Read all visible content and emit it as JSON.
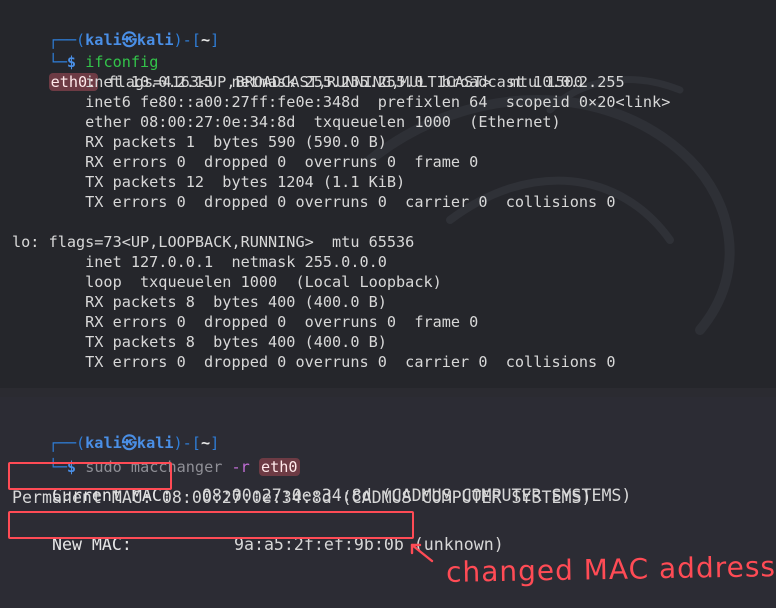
{
  "panel1": {
    "prompt": {
      "open": "┌──(",
      "user": "kali",
      "at": "㉿",
      "host": "kali",
      "close": ")-[",
      "path": "~",
      "end": "]"
    },
    "prompt2": {
      "lead": "└─",
      "dollar": "$",
      "command": "ifconfig"
    },
    "eth0_label": "eth0:",
    "eth0_lines": [
      "flags=4163<UP,BROADCAST,RUNNING,MULTICAST>  mtu 1500",
      "        inet 10.0.2.15  netmask 255.255.255.0  broadcast 10.0.2.255",
      "        inet6 fe80::a00:27ff:fe0e:348d  prefixlen 64  scopeid 0×20<link>",
      "        ether 08:00:27:0e:34:8d  txqueuelen 1000  (Ethernet)",
      "        RX packets 1  bytes 590 (590.0 B)",
      "        RX errors 0  dropped 0  overruns 0  frame 0",
      "        TX packets 12  bytes 1204 (1.1 KiB)",
      "        TX errors 0  dropped 0 overruns 0  carrier 0  collisions 0"
    ],
    "lo_lines": [
      "lo: flags=73<UP,LOOPBACK,RUNNING>  mtu 65536",
      "        inet 127.0.0.1  netmask 255.0.0.0",
      "        loop  txqueuelen 1000  (Local Loopback)",
      "        RX packets 8  bytes 400 (400.0 B)",
      "        RX errors 0  dropped 0  overruns 0  frame 0",
      "        TX packets 8  bytes 400 (400.0 B)",
      "        TX errors 0  dropped 0 overruns 0  carrier 0  collisions 0"
    ]
  },
  "panel2": {
    "prompt": {
      "open": "┌──(",
      "user": "kali",
      "at": "㉿",
      "host": "kali",
      "close": ")-[",
      "path": "~",
      "end": "]"
    },
    "prompt2": {
      "lead": "└─",
      "dollar": "$",
      "cmd_sudo": "sudo",
      "cmd_prog": "macchanger",
      "cmd_flag": "-r",
      "cmd_iface": "eth0"
    },
    "current_label": "Current MAC:",
    "current_value": "   08:00:27:0e:34:8d (CADMUS COMPUTER SYSTEMS)",
    "permanent_line": "Permanent MAC: 08:00:27:0e:34:8d (CADMUS COMPUTER SYSTEMS)",
    "new_label": "New MAC:",
    "new_value": "9a:a5:2f:ef:9b:0b",
    "new_suffix": " (unknown)",
    "annotation": "changed MAC address"
  },
  "colors": {
    "accent_red": "#ff4b55",
    "prompt_blue": "#2f7ed8",
    "prompt_green": "#33c34a",
    "background": "#25262b"
  },
  "icons": {
    "annotation_arrow": "arrow-icon",
    "watermark": "kali-dragon-watermark"
  }
}
